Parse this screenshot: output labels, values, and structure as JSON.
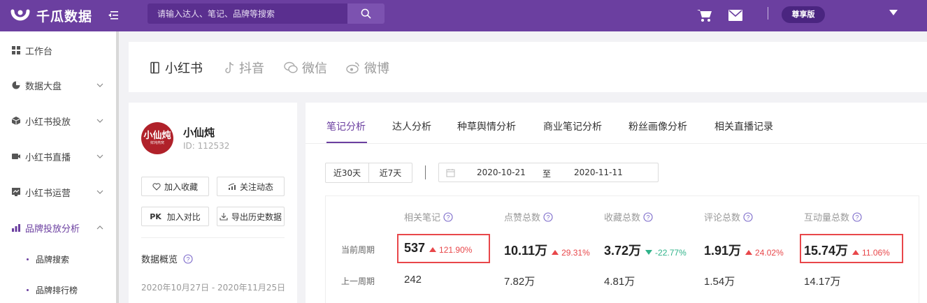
{
  "header": {
    "logo_text": "千瓜数据",
    "search_placeholder": "请输入达人、笔记、品牌等搜索",
    "vip_label": "尊享版"
  },
  "sidebar": {
    "items": [
      {
        "label": "工作台",
        "icon": "grid-icon"
      },
      {
        "label": "数据大盘",
        "icon": "pie-icon"
      },
      {
        "label": "小红书投放",
        "icon": "box-icon"
      },
      {
        "label": "小红书直播",
        "icon": "video-icon"
      },
      {
        "label": "小红书运营",
        "icon": "chart-icon"
      },
      {
        "label": "品牌投放分析",
        "icon": "bar-chart-icon"
      }
    ],
    "sub_items": [
      "品牌搜索",
      "品牌排行榜"
    ]
  },
  "platform_tabs": [
    "小红书",
    "抖音",
    "微信",
    "微博"
  ],
  "profile": {
    "avatar_text": "小仙炖",
    "avatar_sub": "鲜炖燕窝",
    "name": "小仙炖",
    "id_label": "ID:  112532",
    "btn_fav": "加入收藏",
    "btn_follow": "关注动态",
    "btn_compare": "加入对比",
    "btn_compare_prefix": "PK",
    "btn_export": "导出历史数据",
    "overview_label": "数据概览",
    "date_range": "2020年10月27日 - 2020年11月25日"
  },
  "analysis_tabs": [
    "笔记分析",
    "达人分析",
    "种草舆情分析",
    "商业笔记分析",
    "粉丝画像分析",
    "相关直播记录"
  ],
  "filters": {
    "range_30": "近30天",
    "range_7": "近7天",
    "date_start": "2020-10-21",
    "date_sep": "至",
    "date_end": "2020-11-11"
  },
  "stats": {
    "row_current": "当前周期",
    "row_previous": "上一周期",
    "metrics": [
      {
        "label": "相关笔记",
        "current": "537",
        "change": "121.90%",
        "trend": "up",
        "previous": "242"
      },
      {
        "label": "点赞总数",
        "current": "10.11万",
        "change": "29.31%",
        "trend": "up",
        "previous": "7.82万"
      },
      {
        "label": "收藏总数",
        "current": "3.72万",
        "change": "-22.77%",
        "trend": "down",
        "previous": "4.81万"
      },
      {
        "label": "评论总数",
        "current": "1.91万",
        "change": "24.02%",
        "trend": "up",
        "previous": "1.54万"
      },
      {
        "label": "互动量总数",
        "current": "15.74万",
        "change": "11.06%",
        "trend": "up",
        "previous": "14.17万"
      }
    ]
  },
  "colors": {
    "brand": "#6b3fa0",
    "up": "#e8474a",
    "down": "#30b38a",
    "highlight": "#e8474a"
  }
}
